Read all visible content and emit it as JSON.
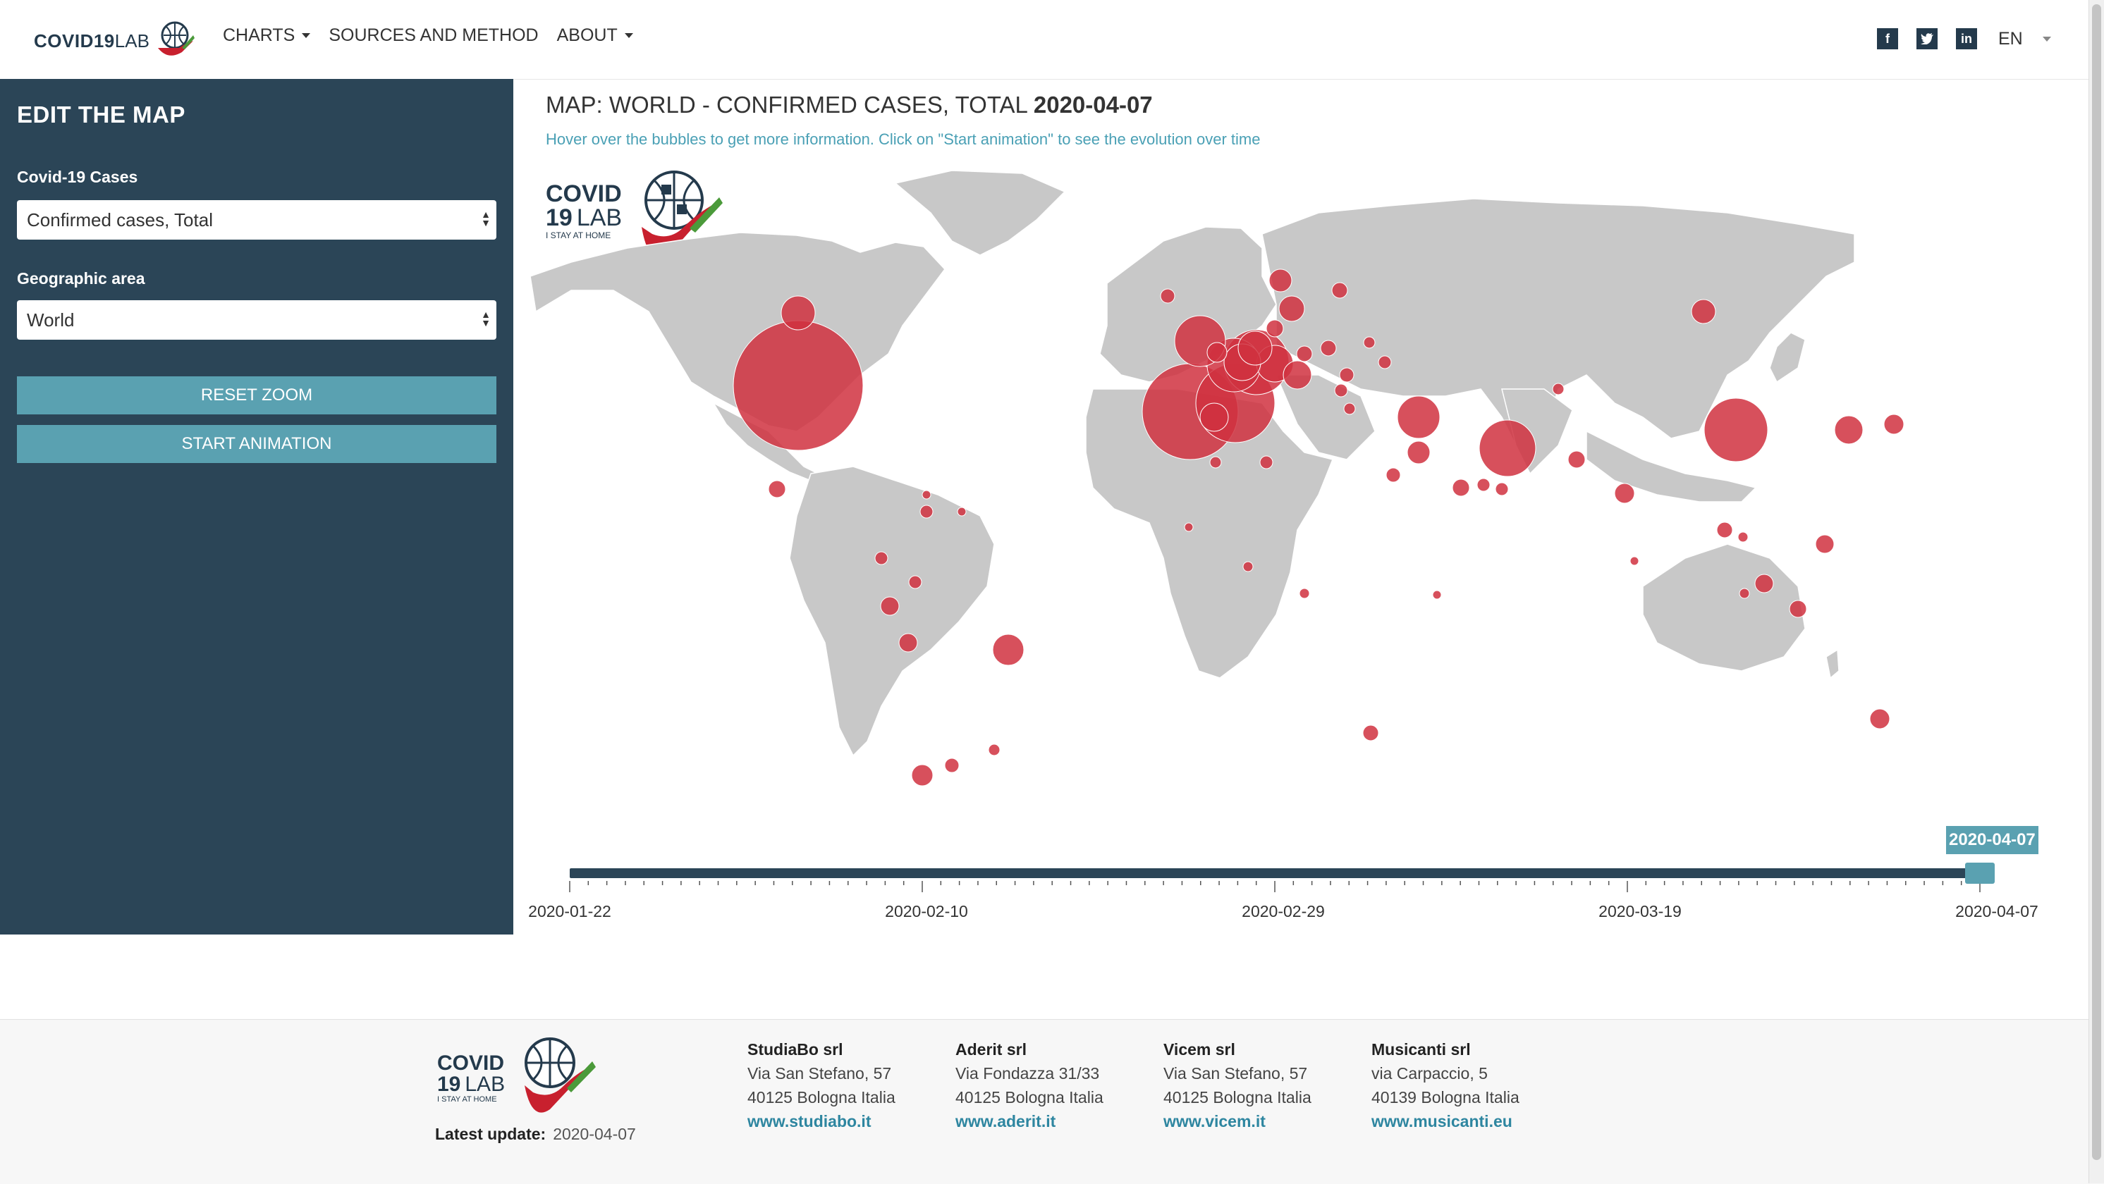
{
  "header": {
    "logo_bold": "COVID19",
    "logo_light": "LAB",
    "nav": [
      {
        "label": "CHARTS",
        "dropdown": true
      },
      {
        "label": "SOURCES AND METHOD",
        "dropdown": false
      },
      {
        "label": "ABOUT",
        "dropdown": true
      }
    ],
    "social": [
      {
        "icon": "facebook-icon",
        "glyph": "f"
      },
      {
        "icon": "twitter-icon",
        "glyph": "t"
      },
      {
        "icon": "linkedin-icon",
        "glyph": "in"
      }
    ],
    "language": "EN"
  },
  "sidebar": {
    "title": "EDIT THE MAP",
    "cases_label": "Covid-19 Cases",
    "cases_value": "Confirmed cases, Total",
    "area_label": "Geographic area",
    "area_value": "World",
    "reset_zoom": "RESET ZOOM",
    "start_animation": "START ANIMATION"
  },
  "main": {
    "title_prefix": "MAP: WORLD - CONFIRMED CASES, TOTAL",
    "title_date": "2020-04-07",
    "subtitle": "Hover over the bubbles to get more information. Click on \"Start animation\" to see the evolution over time",
    "map_logo": {
      "line1": "COVID",
      "line2_bold": "19",
      "line2_light": "LAB",
      "tagline": "I STAY AT HOME"
    }
  },
  "timeline": {
    "current": "2020-04-07",
    "position": 1.0,
    "ticks": [
      "2020-01-22",
      "2020-02-10",
      "2020-02-29",
      "2020-03-19",
      "2020-04-07"
    ]
  },
  "footer": {
    "logo": {
      "line1": "COVID",
      "line2_bold": "19",
      "line2_light": "LAB",
      "tagline": "I STAY AT HOME"
    },
    "latest_label": "Latest update:",
    "latest_value": "2020-04-07",
    "companies": [
      {
        "name": "StudiaBo srl",
        "addr1": "Via San Stefano, 57",
        "addr2": "40125 Bologna Italia",
        "web": "www.studiabo.it"
      },
      {
        "name": "Aderit srl",
        "addr1": "Via Fondazza 31/33",
        "addr2": "40125 Bologna Italia",
        "web": "www.aderit.it"
      },
      {
        "name": "Vicem srl",
        "addr1": "Via San Stefano, 57",
        "addr2": "40125 Bologna Italia",
        "web": "www.vicem.it"
      },
      {
        "name": "Musicanti srl",
        "addr1": "via Carpaccio, 5",
        "addr2": "40139 Bologna Italia",
        "web": "www.musicanti.eu"
      }
    ]
  },
  "colors": {
    "sidebar": "#2b4557",
    "accent": "#5aa1b1",
    "bubble": "#d0313f",
    "land": "#c8c8c8"
  }
}
